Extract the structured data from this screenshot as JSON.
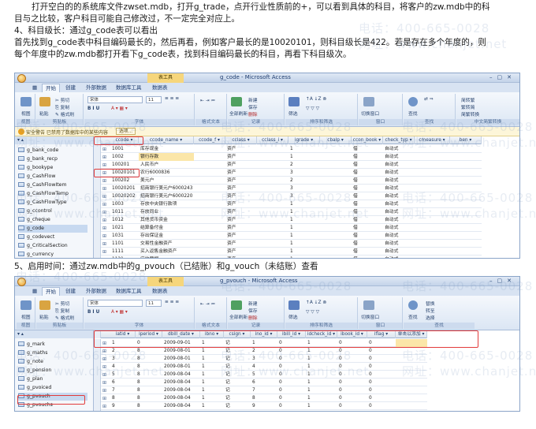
{
  "article": {
    "p1": "打开空白的的系统库文件zwset.mdb，打开g_trade，点开行业性质前的+，可以看到具体的科目，将客户的zw.mdb中的科",
    "p1b": "目与之比较，客户科目可能自己修改过，不一定完全对应上。",
    "h4": "4、科目级长：通过g_code表可以看出",
    "p4a": "首先找到g_code表中科目编码最长的，然后再看，例如客户最长的是10020101，则科目级长是422。若是存在多个年度的，则",
    "p4b": "每个年度中的zw.mdb都打开看下g_code表，找到科目编码最长的科目，再看下科目级次。",
    "h5": "5、启用时间：通过zw.mdb中的g_pvouch（已结账）和g_vouch（未结账）查看"
  },
  "watermark": {
    "phone": "电话：400-665-0028",
    "site": "网址：www.chanjet.net"
  },
  "shot1": {
    "window_title": "g_code - Microsoft Access",
    "context_tab": "表工具",
    "tabs": [
      "开始",
      "创建",
      "外部数据",
      "数据库工具",
      "数据表"
    ],
    "font_name": "宋体",
    "font_size": "11",
    "ribbon_groups": [
      "视图",
      "剪贴板",
      "字体",
      "格式文本",
      "记录",
      "排序和筛选",
      "窗口",
      "查找",
      "中文简繁转换"
    ],
    "ribbon_buttons": [
      "视图",
      "粘贴",
      "全部刷新",
      "新建",
      "保存",
      "删除",
      "筛选",
      "切换窗口",
      "查找",
      "简转繁",
      "繁转简",
      "简繁转换"
    ],
    "security_text": "安全警告  已禁用了数据库中的某些内容",
    "security_option": "选项...",
    "nav_items": [
      "g_bank_code",
      "g_bank_recp",
      "g_bookype",
      "g_CashFlow",
      "g_CashFlowItem",
      "g_CashFlowTemp",
      "g_CashFlowType",
      "g_ccontrol",
      "g_cheque",
      "g_code",
      "g_codevect",
      "g_CriticalSection",
      "g_currency"
    ],
    "nav_selected": "g_code",
    "columns": [
      "ccode",
      "ccode_name",
      "ccode_f",
      "cclass",
      "cclass_i",
      "igrade",
      "cbalp",
      "ccon_book",
      "check_typ",
      "cmeasure",
      "ben"
    ],
    "rows": [
      [
        "1001",
        "库存现金",
        "",
        "资产",
        "",
        "1",
        "",
        "借",
        "自动式",
        "",
        ""
      ],
      [
        "1002",
        "银行存款",
        "",
        "资产",
        "",
        "1",
        "",
        "借",
        "自动式",
        "",
        ""
      ],
      [
        "100201",
        "人民币户",
        "",
        "资产",
        "",
        "2",
        "",
        "借",
        "自动式",
        "",
        ""
      ],
      [
        "10020101",
        "农行6000836",
        "",
        "资产",
        "",
        "3",
        "",
        "借",
        "自动式",
        "",
        ""
      ],
      [
        "100202",
        "美元户",
        "",
        "资产",
        "",
        "2",
        "",
        "借",
        "自动式",
        "",
        ""
      ],
      [
        "10020201",
        "招商银行美元户6000243",
        "",
        "资产",
        "",
        "3",
        "",
        "借",
        "自动式",
        "",
        ""
      ],
      [
        "10020202",
        "招商银行美元户6000220",
        "",
        "资产",
        "",
        "3",
        "",
        "借",
        "自动式",
        "",
        ""
      ],
      [
        "1003",
        "存放中央银行款项",
        "",
        "资产",
        "",
        "1",
        "",
        "借",
        "自动式",
        "",
        ""
      ],
      [
        "1011",
        "存放同业",
        "",
        "资产",
        "",
        "1",
        "",
        "借",
        "自动式",
        "",
        ""
      ],
      [
        "1012",
        "其他货币资金",
        "",
        "资产",
        "",
        "1",
        "",
        "借",
        "自动式",
        "",
        ""
      ],
      [
        "1021",
        "结算备付金",
        "",
        "资产",
        "",
        "1",
        "",
        "借",
        "自动式",
        "",
        ""
      ],
      [
        "1031",
        "存出保证金",
        "",
        "资产",
        "",
        "1",
        "",
        "借",
        "自动式",
        "",
        ""
      ],
      [
        "1101",
        "交易性金融资产",
        "",
        "资产",
        "",
        "1",
        "",
        "借",
        "自动式",
        "",
        ""
      ],
      [
        "1111",
        "买入返售金融资产",
        "",
        "资产",
        "",
        "1",
        "",
        "借",
        "自动式",
        "",
        ""
      ],
      [
        "1121",
        "应收票据",
        "",
        "资产",
        "",
        "1",
        "",
        "借",
        "自动式",
        "",
        ""
      ],
      [
        "1122",
        "应收账款",
        "",
        "资产",
        "",
        "1",
        "",
        "借",
        "自动式",
        "",
        ""
      ]
    ]
  },
  "shot2": {
    "window_title": "g_pvouch - Microsoft Access",
    "context_tab": "表工具",
    "tabs": [
      "开始",
      "创建",
      "外部数据",
      "数据库工具",
      "数据表"
    ],
    "font_name": "宋体",
    "font_size": "11",
    "ribbon_groups": [
      "视图",
      "剪贴板",
      "字体",
      "格式文本",
      "记录",
      "排序和筛选",
      "窗口",
      "查找"
    ],
    "ribbon_buttons": [
      "视图",
      "粘贴",
      "全部刷新",
      "新建",
      "保存",
      "删除",
      "筛选",
      "切换窗口",
      "查找",
      "替换",
      "转至",
      "选择"
    ],
    "nav_items": [
      "g_mark",
      "g_maths",
      "g_note",
      "g_pension",
      "g_plan",
      "g_pvoiced",
      "g_pvouch",
      "g_pvouchs"
    ],
    "nav_selected": "g_pvouch",
    "columns": [
      "iatid",
      "iperiod",
      "dbill_date",
      "ibno",
      "csign",
      "ino_id",
      "ibill_id",
      "idcheck_id",
      "ibook_id",
      "iflag",
      "单击以添加"
    ],
    "rows": [
      [
        "1",
        "0",
        "2009-09-01",
        "1",
        "记",
        "1",
        "0",
        "1",
        "0",
        "0",
        ""
      ],
      [
        "2",
        "8",
        "2009-08-01",
        "1",
        "记",
        "2",
        "0",
        "1",
        "0",
        "0",
        ""
      ],
      [
        "3",
        "8",
        "2009-08-01",
        "1",
        "记",
        "3",
        "0",
        "1",
        "0",
        "0",
        ""
      ],
      [
        "4",
        "8",
        "2009-08-01",
        "1",
        "记",
        "4",
        "0",
        "1",
        "0",
        "0",
        ""
      ],
      [
        "5",
        "8",
        "2009-08-04",
        "1",
        "记",
        "5",
        "0",
        "1",
        "0",
        "0",
        ""
      ],
      [
        "6",
        "8",
        "2009-08-04",
        "1",
        "记",
        "6",
        "0",
        "1",
        "0",
        "0",
        ""
      ],
      [
        "7",
        "8",
        "2009-08-04",
        "1",
        "记",
        "7",
        "0",
        "1",
        "0",
        "0",
        ""
      ],
      [
        "8",
        "8",
        "2009-08-04",
        "1",
        "记",
        "8",
        "0",
        "1",
        "0",
        "0",
        ""
      ],
      [
        "9",
        "8",
        "2009-08-04",
        "1",
        "记",
        "9",
        "0",
        "1",
        "0",
        "0",
        ""
      ],
      [
        "10",
        "8",
        "2009-08-07",
        "1",
        "记",
        "10",
        "0",
        "1",
        "0",
        "0",
        ""
      ]
    ]
  },
  "colors": {
    "highlight_box": "#e23b3b",
    "ribbon_blue": "#dbe6f4",
    "title_text": "#1e3c6e"
  }
}
